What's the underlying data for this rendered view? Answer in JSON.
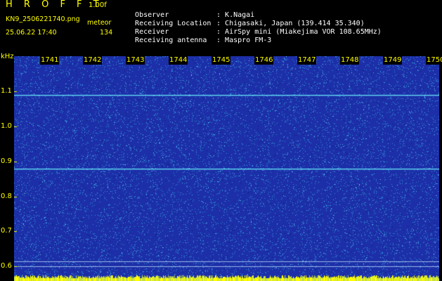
{
  "header": {
    "title": "H R O F F T",
    "version": "1.00f",
    "file_name": "KN9_2506221740.png",
    "mode": "meteor",
    "datetime": "25.06.22 17:40",
    "count": "134"
  },
  "info": [
    {
      "key": "Observer",
      "value": "K.Nagai"
    },
    {
      "key": "Receiving Location",
      "value": "Chigasaki, Japan (139.414 35.340)"
    },
    {
      "key": "Receiver",
      "value": "AirSpy mini (Miakejima VOR 108.65MHz)"
    },
    {
      "key": "Receiving antenna",
      "value": "Maspro FM-3"
    }
  ],
  "plot": {
    "unit": "kHz",
    "x_ticks": [
      "1741",
      "1742",
      "1743",
      "1744",
      "1745",
      "1746",
      "1747",
      "1748",
      "1749",
      "1750"
    ],
    "y_ticks": [
      "1.1",
      "1.0",
      "0.9",
      "0.8",
      "0.7",
      "0.6"
    ],
    "y_range": [
      0.58,
      1.2
    ],
    "lines_khz": [
      1.09,
      0.88,
      0.615,
      0.6
    ],
    "colors": {
      "background": "#1c2fa8",
      "noise_light": "#2f8fd8",
      "noise_bright": "#7ed2ff",
      "line": "#63e0f5",
      "bottom_strip": "#ffff00"
    }
  }
}
